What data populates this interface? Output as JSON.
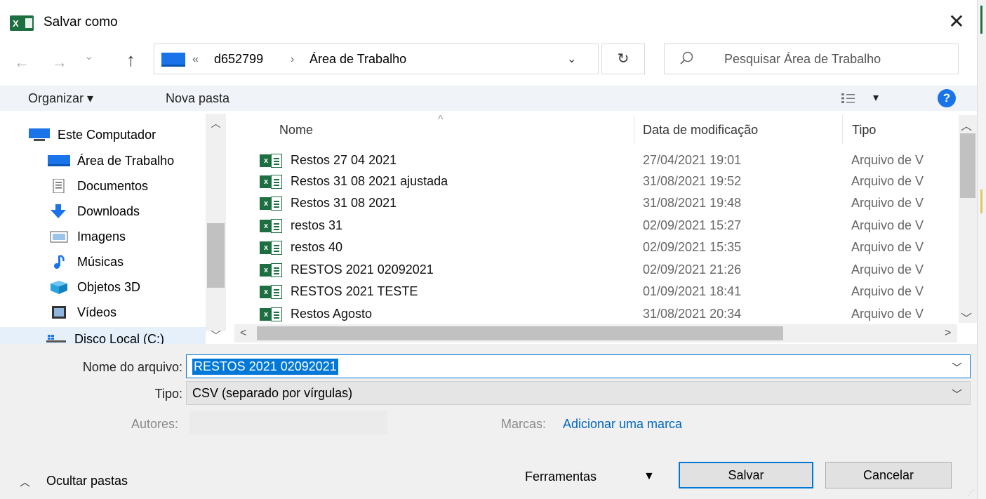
{
  "window": {
    "title": "Salvar como",
    "app_badge": "X",
    "close_label": "✕"
  },
  "navigation": {
    "back": "←",
    "forward": "→",
    "recent": "⌄",
    "up": "↑",
    "breadcrumb_overflow": "«",
    "path": [
      "d652799",
      "Área de Trabalho"
    ],
    "path_separator": "›",
    "dropdown": "⌄",
    "refresh": "↻"
  },
  "search": {
    "placeholder": "Pesquisar Área de Trabalho",
    "icon": "search-icon"
  },
  "toolbar": {
    "organize": "Organizar ▾",
    "new_folder": "Nova pasta",
    "view_options": "▾",
    "help": "?"
  },
  "sidebar": {
    "items": [
      {
        "label": "Este Computador",
        "icon": "computer-icon",
        "selected": false
      },
      {
        "label": "Área de Trabalho",
        "icon": "desktop-icon",
        "selected": false
      },
      {
        "label": "Documentos",
        "icon": "documents-icon",
        "selected": false
      },
      {
        "label": "Downloads",
        "icon": "downloads-icon",
        "selected": false
      },
      {
        "label": "Imagens",
        "icon": "pictures-icon",
        "selected": false
      },
      {
        "label": "Músicas",
        "icon": "music-icon",
        "selected": false
      },
      {
        "label": "Objetos 3D",
        "icon": "objects-3d-icon",
        "selected": false
      },
      {
        "label": "Vídeos",
        "icon": "videos-icon",
        "selected": false
      },
      {
        "label": "Disco Local (C:)",
        "icon": "local-disk-icon",
        "selected": true
      }
    ]
  },
  "file_list": {
    "columns": {
      "name": "Nome",
      "date": "Data de modificação",
      "type": "Tipo"
    },
    "sort_indicator": "^",
    "files": [
      {
        "name": "Restos 27 04 2021",
        "date": "27/04/2021 19:01",
        "type": "Arquivo de V"
      },
      {
        "name": "Restos 31 08 2021 ajustada",
        "date": "31/08/2021 19:52",
        "type": "Arquivo de V"
      },
      {
        "name": "Restos 31 08 2021",
        "date": "31/08/2021 19:48",
        "type": "Arquivo de V"
      },
      {
        "name": "restos 31",
        "date": "02/09/2021 15:27",
        "type": "Arquivo de V"
      },
      {
        "name": "restos 40",
        "date": "02/09/2021 15:35",
        "type": "Arquivo de V"
      },
      {
        "name": "RESTOS 2021 02092021",
        "date": "02/09/2021 21:26",
        "type": "Arquivo de V"
      },
      {
        "name": "RESTOS 2021 TESTE",
        "date": "01/09/2021 18:41",
        "type": "Arquivo de V"
      },
      {
        "name": "Restos Agosto",
        "date": "31/08/2021 20:34",
        "type": "Arquivo de V"
      }
    ]
  },
  "form": {
    "filename_label": "Nome do arquivo:",
    "filename_value": "RESTOS 2021 02092021",
    "type_label": "Tipo:",
    "type_value": "CSV (separado por vírgulas)",
    "authors_label": "Autores:",
    "tags_label": "Marcas:",
    "tags_link": "Adicionar uma marca"
  },
  "footer": {
    "hide_folders": "Ocultar pastas",
    "tools": "Ferramentas",
    "save": "Salvar",
    "cancel": "Cancelar"
  },
  "colors": {
    "accent": "#0078d7",
    "excel_green": "#1d6f42",
    "selection": "#0078d7",
    "toolbar_bg": "#f0f4f9"
  }
}
